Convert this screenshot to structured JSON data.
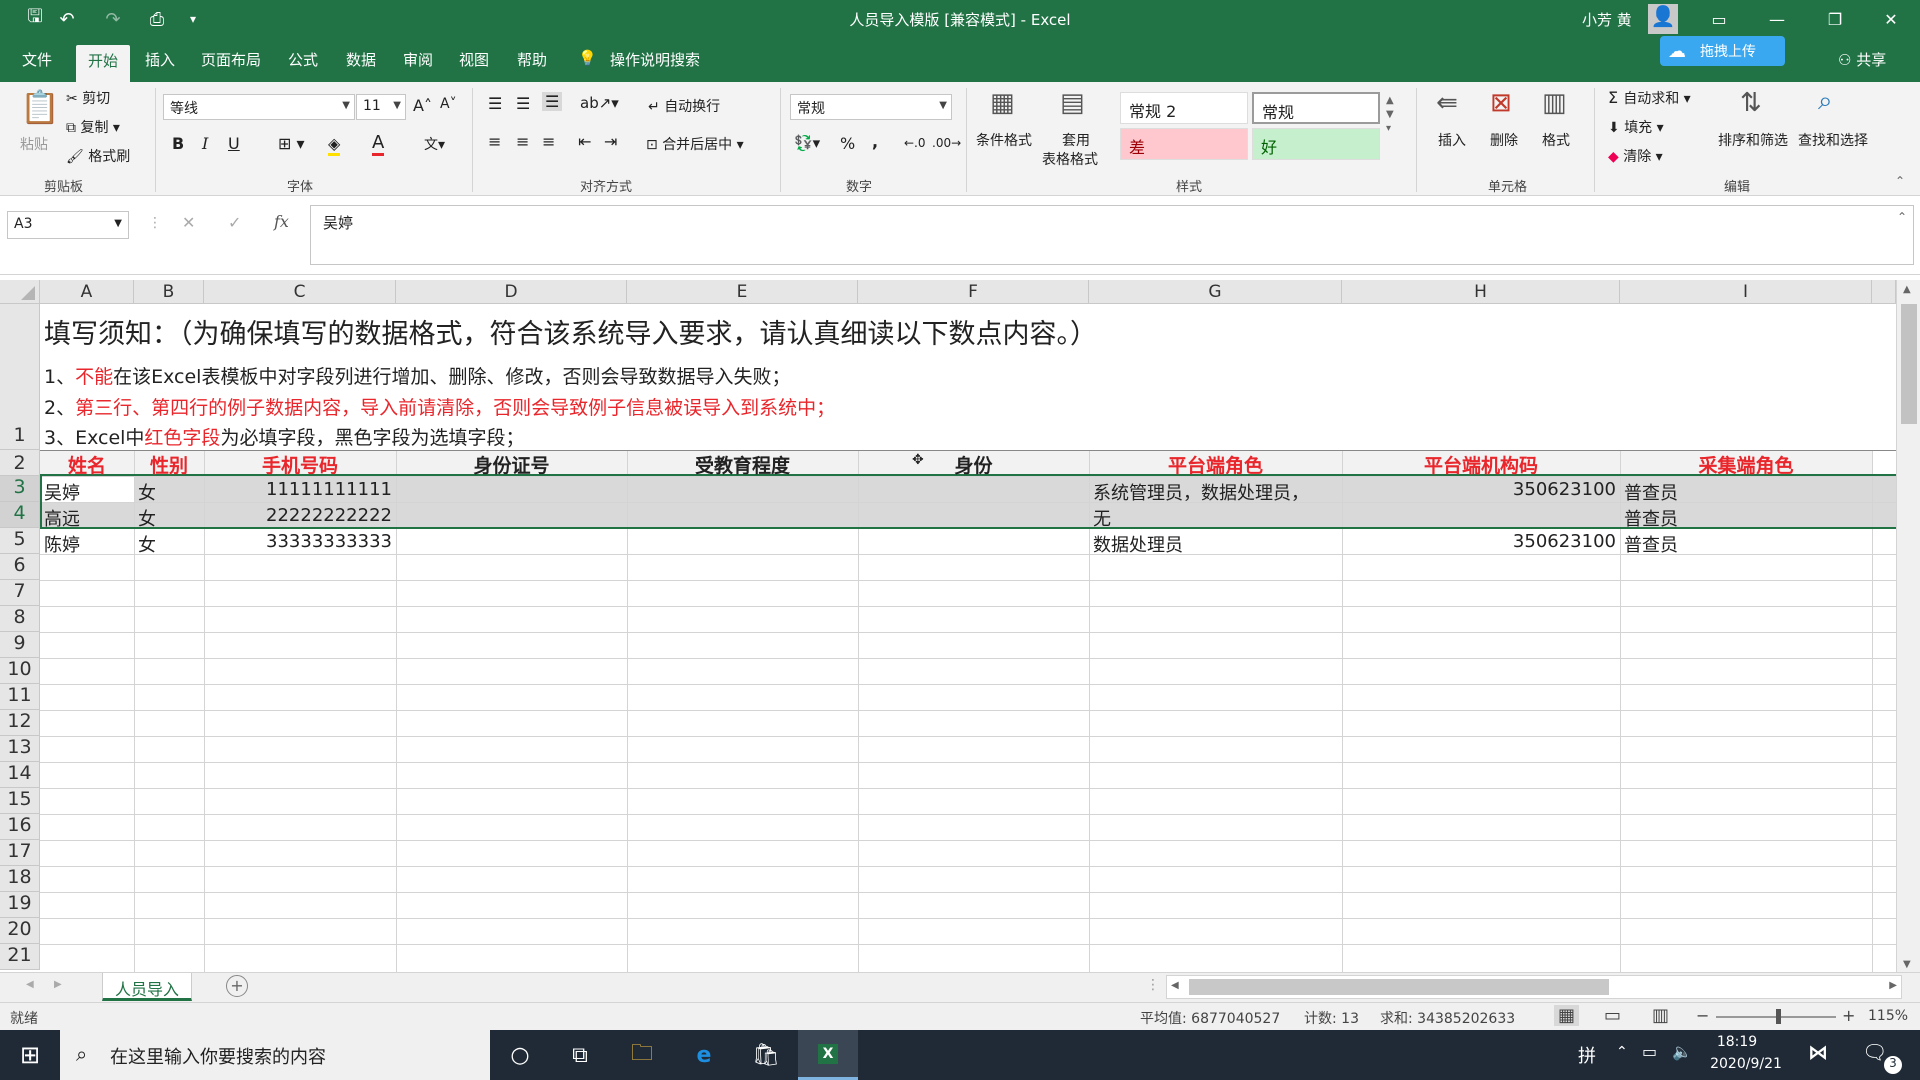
{
  "window": {
    "title": "人员导入模版 [兼容模式] - Excel",
    "user": "小芳 黄"
  },
  "menu": {
    "tabs": [
      "文件",
      "开始",
      "插入",
      "页面布局",
      "公式",
      "数据",
      "审阅",
      "视图",
      "帮助"
    ],
    "tell_me": "操作说明搜索",
    "upload": "拖拽上传",
    "share": "共享"
  },
  "ribbon": {
    "clipboard": {
      "paste": "粘贴",
      "cut": "剪切",
      "copy": "复制",
      "format_painter": "格式刷",
      "label": "剪贴板"
    },
    "font": {
      "name": "等线",
      "size": "11",
      "bold": "B",
      "italic": "I",
      "underline": "U",
      "label": "字体"
    },
    "alignment": {
      "wrap": "自动换行",
      "merge": "合并后居中",
      "label": "对齐方式"
    },
    "number": {
      "format": "常规",
      "percent": "%",
      "comma": ",",
      "label": "数字"
    },
    "styles": {
      "conditional": "条件格式",
      "table_line1": "套用",
      "table_line2": "表格格式",
      "normal2": "常规 2",
      "normal": "常规",
      "bad": "差",
      "good": "好",
      "label": "样式"
    },
    "cells": {
      "insert": "插入",
      "delete": "删除",
      "format": "格式",
      "label": "单元格"
    },
    "editing": {
      "autosum": "自动求和",
      "fill": "填充",
      "clear": "清除",
      "sort": "排序和筛选",
      "find": "查找和选择",
      "label": "编辑"
    }
  },
  "formula_bar": {
    "name_box": "A3",
    "fx": "fx",
    "content": "吴婷"
  },
  "sheet": {
    "columns": [
      "A",
      "B",
      "C",
      "D",
      "E",
      "F",
      "G",
      "H",
      "I"
    ],
    "rows": [
      "1",
      "2",
      "3",
      "4",
      "5",
      "6",
      "7",
      "8",
      "9",
      "10",
      "11",
      "12",
      "13",
      "14",
      "15",
      "16",
      "17",
      "18",
      "19",
      "20",
      "21"
    ],
    "notice_title": "填写须知：（为确保填写的数据格式，符合该系统导入要求，请认真细读以下数点内容。）",
    "notice1_a": "1、",
    "notice1_b": "不能",
    "notice1_c": "在该Excel表模板中对字段列进行增加、删除、修改，否则会导致数据导入失败；",
    "notice2_a": "2、",
    "notice2_b": "第三行、第四行的例子数据内容，导入前请清除，否则会导致例子信息被误导入到系统中；",
    "notice3_a": "3、Excel中",
    "notice3_b": "红色字段",
    "notice3_c": "为必填字段，黑色字段为选填字段；",
    "headers": [
      "姓名",
      "性别",
      "手机号码",
      "身份证号",
      "受教育程度",
      "身份",
      "平台端角色",
      "平台端机构码",
      "采集端角色"
    ],
    "data_rows": [
      {
        "name": "吴婷",
        "gender": "女",
        "phone": "11111111111",
        "id": "",
        "edu": "",
        "identity": "",
        "role": "系统管理员，数据处理员，",
        "org": "350623100",
        "collect": "普查员"
      },
      {
        "name": "高远",
        "gender": "女",
        "phone": "22222222222",
        "id": "",
        "edu": "",
        "identity": "",
        "role": "无",
        "org": "",
        "collect": "普查员"
      },
      {
        "name": "陈婷",
        "gender": "女",
        "phone": "33333333333",
        "id": "",
        "edu": "",
        "identity": "",
        "role": "数据处理员",
        "org": "350623100",
        "collect": "普查员"
      }
    ],
    "tab": "人员导入"
  },
  "status": {
    "ready": "就绪",
    "average": "平均值: 6877040527",
    "count": "计数: 13",
    "sum": "求和: 34385202633",
    "zoom": "115%"
  },
  "taskbar": {
    "search": "在这里输入你要搜索的内容",
    "ime": "拼",
    "time": "18:19",
    "date": "2020/9/21",
    "notifications": "3"
  }
}
